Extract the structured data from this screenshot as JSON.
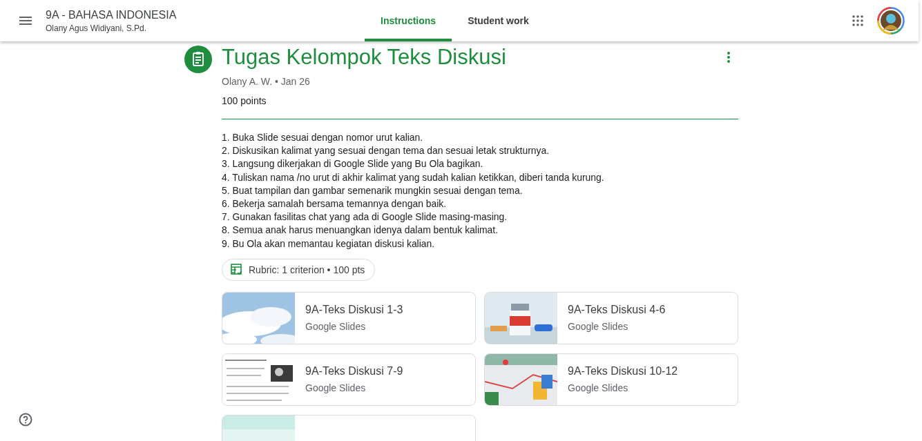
{
  "header": {
    "class_name": "9A - BAHASA INDONESIA",
    "teacher": "Olany Agus Widiyani, S.Pd."
  },
  "tabs": [
    {
      "label": "Instructions",
      "selected": true
    },
    {
      "label": "Student work",
      "selected": false
    }
  ],
  "assignment": {
    "title": "Tugas Kelompok Teks Diskusi",
    "meta": "Olany A. W. • Jan 26",
    "points": "100 points",
    "instructions": [
      "1. Buka Slide sesuai dengan nomor urut kalian.",
      "2. Diskusikan kalimat yang sesuai dengan tema dan sesuai letak strukturnya.",
      "3. Langsung dikerjakan di Google Slide yang Bu Ola bagikan.",
      "4. Tuliskan nama /no urut di akhir kalimat yang sudah kalian ketikkan, diberi tanda kurung.",
      "5. Buat tampilan dan gambar semenarik mungkin sesuai dengan tema.",
      "6. Bekerja samalah bersama temannya dengan baik.",
      "7. Gunakan fasilitas chat yang ada di Google Slide masing-masing.",
      "8. Semua anak harus menuangkan idenya dalam bentuk kalimat.",
      "9. Bu Ola akan memantau kegiatan diskusi kalian."
    ],
    "rubric": "Rubric: 1 criterion • 100 pts",
    "attachments": [
      {
        "kind": "file",
        "title": "9A-Teks Diskusi 1-3",
        "type": "Google Slides"
      },
      {
        "kind": "file",
        "title": "9A-Teks Diskusi 4-6",
        "type": "Google Slides"
      },
      {
        "kind": "file",
        "title": "9A-Teks Diskusi 7-9",
        "type": "Google Slides"
      },
      {
        "kind": "file",
        "title": "9A-Teks Diskusi 10-12",
        "type": "Google Slides"
      },
      {
        "kind": "picture"
      }
    ]
  }
}
